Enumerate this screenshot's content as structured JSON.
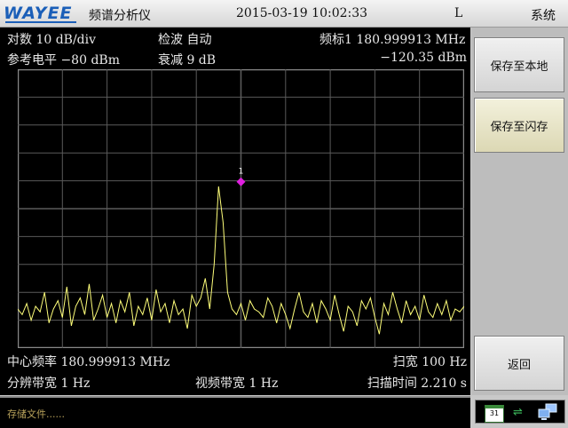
{
  "header": {
    "logo": "WAYEE",
    "title": "频谱分析仪",
    "datetime": "2015-03-19 10:02:33",
    "mode": "L",
    "system": "系统"
  },
  "display": {
    "scale": "对数 10 dB/div",
    "ref_level": "参考电平 −80 dBm",
    "detector": "检波 自动",
    "attenuation": "衰减 9 dB",
    "marker_freq": "频标1  180.999913 MHz",
    "marker_level": "−120.35 dBm",
    "marker_number": "1",
    "center_freq": "中心频率 180.999913 MHz",
    "span": "扫宽 100 Hz",
    "rbw": "分辨带宽 1 Hz",
    "vbw": "视频带宽 1 Hz",
    "sweep_time": "扫描时间 2.210 s",
    "colors": {
      "trace": "#ffff7a",
      "marker": "#e020e0",
      "grid": "#5a5a5a"
    }
  },
  "softkeys": {
    "save_local": "保存至本地",
    "save_flash": "保存至闪存",
    "back": "返回"
  },
  "statusbar": {
    "message": "存储文件......",
    "calendar_day": "31"
  },
  "chart_data": {
    "type": "line",
    "x": [
      0,
      1,
      2,
      3,
      4,
      5,
      6,
      7,
      8,
      9,
      10,
      11,
      12,
      13,
      14,
      15,
      16,
      17,
      18,
      19,
      20,
      21,
      22,
      23,
      24,
      25,
      26,
      27,
      28,
      29,
      30,
      31,
      32,
      33,
      34,
      35,
      36,
      37,
      38,
      39,
      40,
      41,
      42,
      43,
      44,
      45,
      46,
      47,
      48,
      49,
      50,
      51,
      52,
      53,
      54,
      55,
      56,
      57,
      58,
      59,
      60,
      61,
      62,
      63,
      64,
      65,
      66,
      67,
      68,
      69,
      70,
      71,
      72,
      73,
      74,
      75,
      76,
      77,
      78,
      79,
      80,
      81,
      82,
      83,
      84,
      85,
      86,
      87,
      88,
      89,
      90,
      91,
      92,
      93,
      94,
      95,
      96,
      97,
      98,
      99,
      100
    ],
    "y": [
      -166,
      -168,
      -164,
      -170,
      -165,
      -167,
      -160,
      -171,
      -166,
      -163,
      -169,
      -158,
      -172,
      -165,
      -162,
      -168,
      -157,
      -170,
      -166,
      -161,
      -169,
      -164,
      -171,
      -163,
      -167,
      -160,
      -172,
      -165,
      -168,
      -162,
      -170,
      -159,
      -167,
      -164,
      -171,
      -163,
      -168,
      -166,
      -173,
      -161,
      -165,
      -162,
      -155,
      -166,
      -150,
      -122,
      -135,
      -160,
      -166,
      -168,
      -164,
      -170,
      -163,
      -166,
      -167,
      -169,
      -162,
      -165,
      -171,
      -164,
      -168,
      -173,
      -166,
      -160,
      -167,
      -169,
      -164,
      -171,
      -163,
      -166,
      -170,
      -161,
      -168,
      -174,
      -165,
      -167,
      -172,
      -163,
      -166,
      -162,
      -169,
      -175,
      -164,
      -168,
      -160,
      -166,
      -171,
      -163,
      -168,
      -165,
      -170,
      -161,
      -167,
      -169,
      -164,
      -168,
      -163,
      -170,
      -166,
      -167,
      -165
    ],
    "ylim": [
      -180,
      -80
    ],
    "xlim": [
      0,
      100
    ],
    "grid": true,
    "marker": {
      "x": 50,
      "y": -120.35
    }
  }
}
